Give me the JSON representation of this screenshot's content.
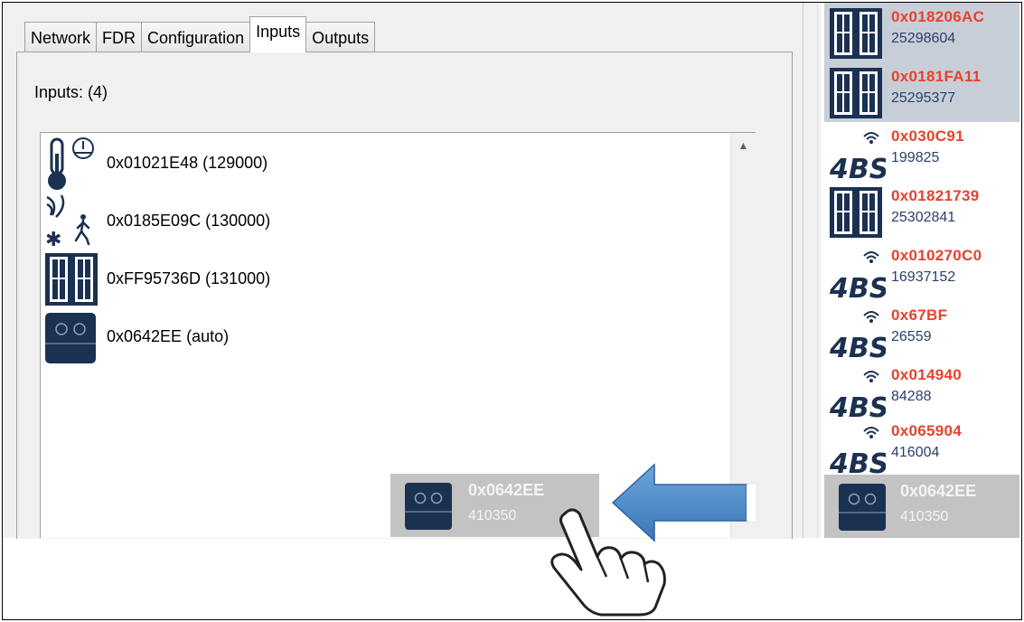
{
  "tabs": [
    {
      "label": "Network"
    },
    {
      "label": "FDR"
    },
    {
      "label": "Configuration"
    },
    {
      "label": "Inputs",
      "active": true
    },
    {
      "label": "Outputs"
    }
  ],
  "inputs_header": "Inputs: (4)",
  "inputs": [
    {
      "icon": "thermometer-sensor-icon",
      "label": "0x01021E48 (129000)"
    },
    {
      "icon": "motion-sensor-icon",
      "label": "0x0185E09C (130000)"
    },
    {
      "icon": "window-contact-icon",
      "label": "0xFF95736D (131000)"
    },
    {
      "icon": "rocker-switch-icon",
      "label": "0x0642EE (auto)"
    }
  ],
  "devices": [
    {
      "icon": "window-contact-icon",
      "id": "0x018206AC",
      "num": "25298604",
      "selected": true
    },
    {
      "icon": "window-contact-icon",
      "id": "0x0181FA11",
      "num": "25295377",
      "selected": true
    },
    {
      "icon": "4bs-wireless-icon",
      "id": "0x030C91",
      "num": "199825"
    },
    {
      "icon": "window-contact-icon",
      "id": "0x01821739",
      "num": "25302841"
    },
    {
      "icon": "4bs-wireless-icon",
      "id": "0x010270C0",
      "num": "16937152"
    },
    {
      "icon": "4bs-wireless-icon",
      "id": "0x67BF",
      "num": "26559"
    },
    {
      "icon": "4bs-wireless-icon",
      "id": "0x014940",
      "num": "84288"
    },
    {
      "icon": "4bs-wireless-icon",
      "id": "0x065904",
      "num": "416004"
    }
  ],
  "dragged_device": {
    "icon": "rocker-switch-icon",
    "id": "0x0642EE",
    "num": "410350"
  },
  "badge_text": "4BS",
  "colors": {
    "device_id": "#e8412c",
    "device_num": "#2a3f6a",
    "icon": "#1b3152",
    "arrow": "#4a86c8",
    "selection": "#c8ced8"
  }
}
